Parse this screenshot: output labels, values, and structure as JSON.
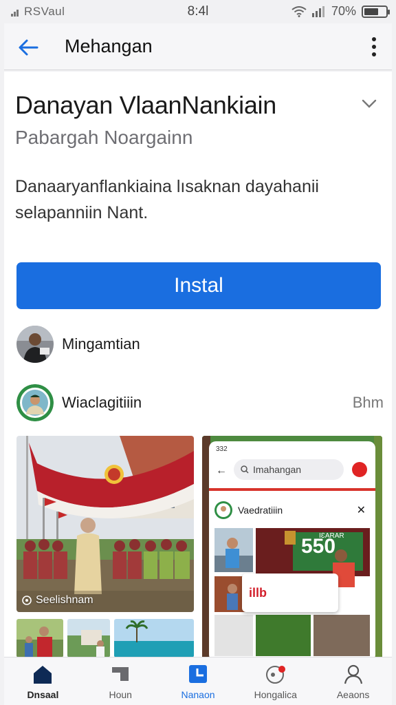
{
  "status": {
    "carrier": "RSVaul",
    "time": "8:4Ɩ",
    "battery": "70%",
    "battery_level": 0.7
  },
  "appbar": {
    "title": "Mehangan"
  },
  "app": {
    "title": "Danayan VlaanNankiain",
    "subtitle": "Pabargah Noargainn",
    "description": "Danaaryanflankiaina lısaknan dayahanii selapanniin Nant.",
    "install_label": "Instal"
  },
  "rows": [
    {
      "label": "Mingamtian",
      "icon": "person-avatar"
    },
    {
      "label": "Wiaclagitiiin",
      "icon": "circle-portrait-avatar",
      "side": "Bhm"
    }
  ],
  "gallery": {
    "shot1_caption": "Seelishnam",
    "shot2": {
      "status": "332",
      "search": "Imahangan",
      "card_label": "Vaedratiiin",
      "score": "550",
      "small_label": "IƐARAR",
      "popup_logo": "illb"
    }
  },
  "nav": [
    {
      "label": "Dnsaal",
      "icon": "home-icon",
      "state": "home"
    },
    {
      "label": "Houn",
      "icon": "folder-icon",
      "state": ""
    },
    {
      "label": "Nanaon",
      "icon": "apps-icon",
      "state": "active"
    },
    {
      "label": "Hongalica",
      "icon": "chat-bubble-icon",
      "state": ""
    },
    {
      "label": "Aeaons",
      "icon": "account-icon",
      "state": ""
    }
  ],
  "colors": {
    "accent": "#1a6ee0",
    "background": "#f1f1f3",
    "card": "#ffffff",
    "flag_red": "#b8202b"
  }
}
